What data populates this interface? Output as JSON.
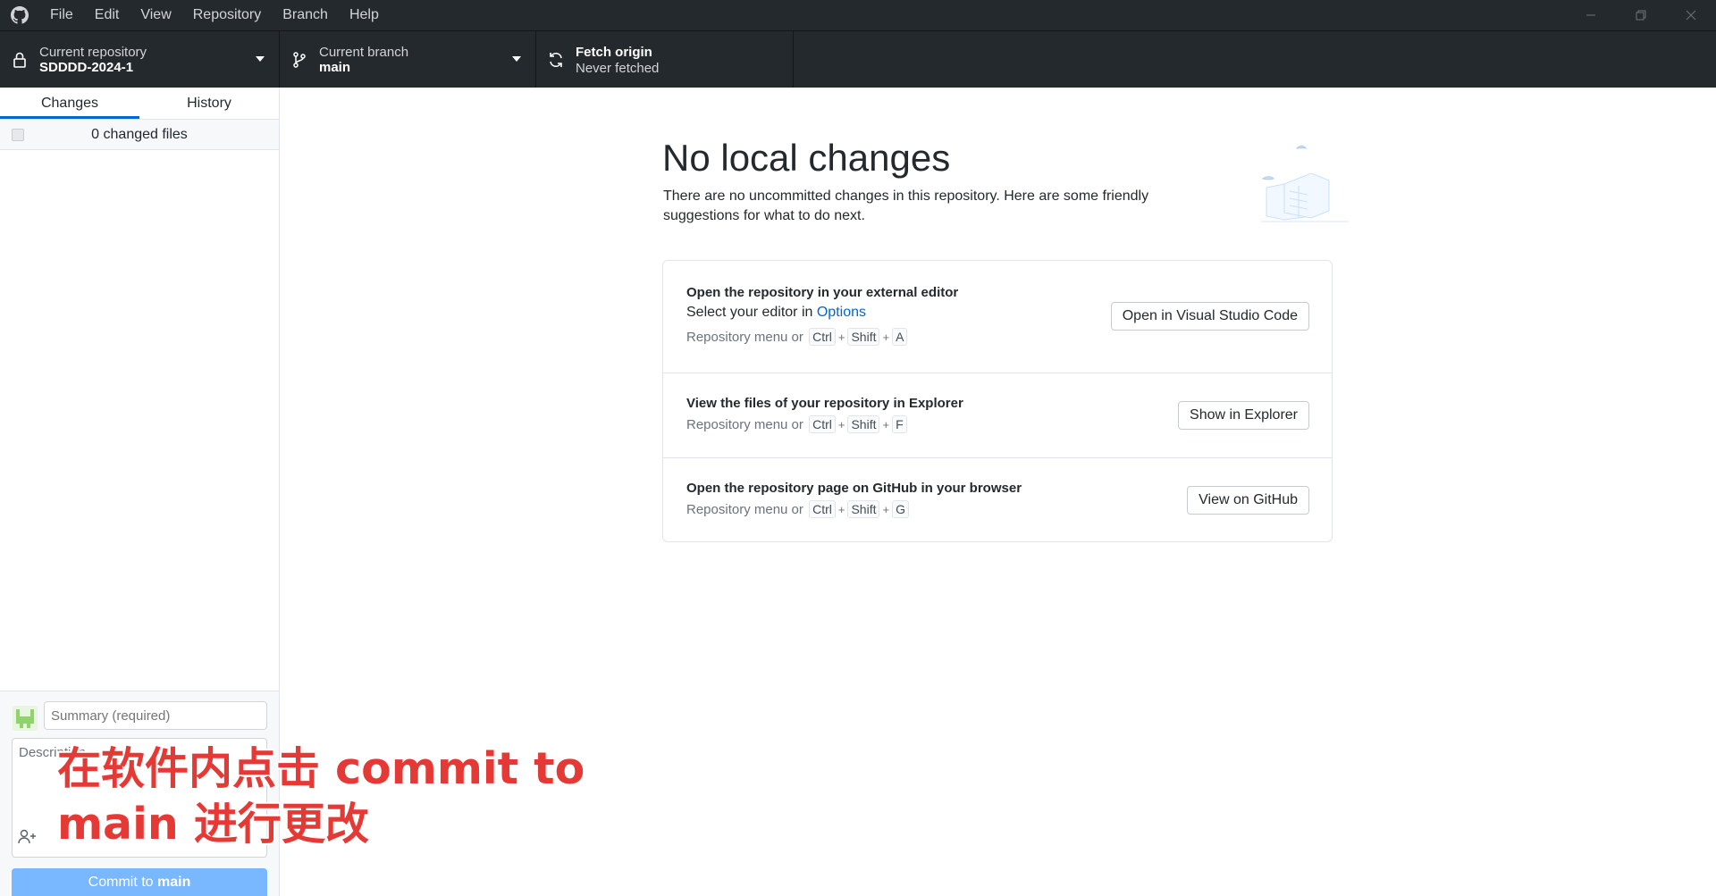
{
  "menu": [
    "File",
    "Edit",
    "View",
    "Repository",
    "Branch",
    "Help"
  ],
  "toolbar": {
    "repo_label": "Current repository",
    "repo_value": "SDDDD-2024-1",
    "branch_label": "Current branch",
    "branch_value": "main",
    "fetch_label": "Fetch origin",
    "fetch_value": "Never fetched"
  },
  "sidebar": {
    "tabs": [
      "Changes",
      "History"
    ],
    "changed_files": "0 changed files",
    "summary_placeholder": "Summary (required)",
    "description_placeholder": "Description",
    "commit_prefix": "Commit to ",
    "commit_branch": "main"
  },
  "main": {
    "heading": "No local changes",
    "subtext": "There are no uncommitted changes in this repository. Here are some friendly suggestions for what to do next.",
    "rows": [
      {
        "title": "Open the repository in your external editor",
        "sub_prefix": "Select your editor in ",
        "sub_link": "Options",
        "hint_prefix": "Repository menu or",
        "keys": [
          "Ctrl",
          "Shift",
          "A"
        ],
        "button": "Open in Visual Studio Code"
      },
      {
        "title": "View the files of your repository in Explorer",
        "hint_prefix": "Repository menu or",
        "keys": [
          "Ctrl",
          "Shift",
          "F"
        ],
        "button": "Show in Explorer"
      },
      {
        "title": "Open the repository page on GitHub in your browser",
        "hint_prefix": "Repository menu or",
        "keys": [
          "Ctrl",
          "Shift",
          "G"
        ],
        "button": "View on GitHub"
      }
    ]
  },
  "caption": {
    "line1": "在软件内点击 commit to",
    "line2": "main 进行更改"
  },
  "colors": {
    "accent": "#0366d6",
    "titlebar": "#24292e",
    "commit_button": "#79b8ff",
    "caption": "#e53935"
  }
}
